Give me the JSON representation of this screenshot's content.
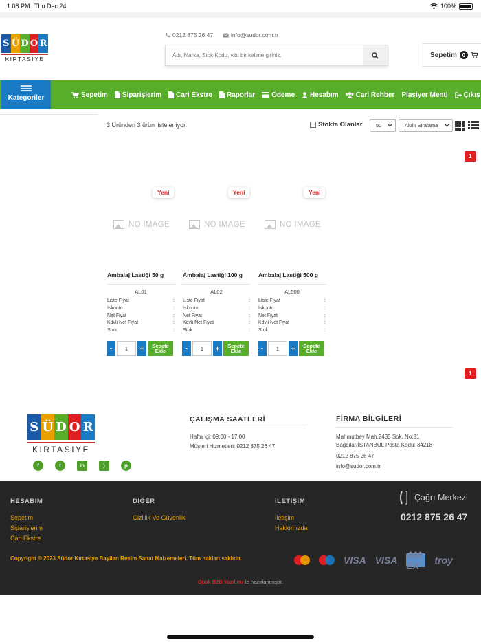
{
  "status_bar": {
    "time": "1:08 PM",
    "date": "Thu Dec 24",
    "battery": "100%"
  },
  "header": {
    "logo": {
      "letters": [
        "S",
        "Ü",
        "D",
        "O",
        "R"
      ],
      "tile_colors": [
        "#1a5aa8",
        "#e8a100",
        "#58ae2b",
        "#e02020",
        "#1a7bc4"
      ],
      "sub": "KIRTASIYE"
    },
    "phone": "0212 875 26 47",
    "email": "info@sudor.com.tr",
    "search_placeholder": "Adı, Marka, Stok Kodu, v.b. bir kelime giriniz.",
    "basket_label": "Sepetim",
    "basket_count": "0"
  },
  "nav": {
    "categories_label": "Kategoriler",
    "items": [
      {
        "label": "Sepetim",
        "icon": "cart-icon"
      },
      {
        "label": "Siparişlerim",
        "icon": "document-icon"
      },
      {
        "label": "Cari Ekstre",
        "icon": "document-icon"
      },
      {
        "label": "Raporlar",
        "icon": "document-icon"
      },
      {
        "label": "Ödeme",
        "icon": "card-icon"
      },
      {
        "label": "Hesabım",
        "icon": "user-icon"
      },
      {
        "label": "Cari Rehber",
        "icon": "users-icon"
      },
      {
        "label": "Plasiyer Menü",
        "icon": ""
      },
      {
        "label": "Çıkış",
        "icon": "logout-icon"
      }
    ],
    "colors": {
      "nav": "#58ae2b",
      "categories": "#1a7bc4"
    }
  },
  "listing": {
    "result_text": "3 Üründen 3 ürün listeleniyor.",
    "stock_only_label": "Stokta Olanlar",
    "page_size": "50",
    "sort": "Akıllı Sıralama",
    "page_badge": "1"
  },
  "products": [
    {
      "badge": "Yeni",
      "no_image": "NO IMAGE",
      "name": "Ambalaj Lastiği 50 g",
      "code": "AL01"
    },
    {
      "badge": "Yeni",
      "no_image": "NO IMAGE",
      "name": "Ambalaj Lastiği 100 g",
      "code": "AL02"
    },
    {
      "badge": "Yeni",
      "no_image": "NO IMAGE",
      "name": "Ambalaj Lastiği 500 g",
      "code": "AL500"
    }
  ],
  "product_fields": [
    "Liste Fiyat",
    "İskonto",
    "Net Fiyat",
    "Kdvli Net Fiyat",
    "Stok"
  ],
  "product_actions": {
    "minus": "-",
    "qty": "1",
    "plus": "+",
    "add_to_cart": "Sepete Ekle"
  },
  "footer": {
    "hours_title": "ÇALIŞMA SAATLERİ",
    "hours": [
      "Hafta içi: 09:00 - 17:00",
      "Müşteri Hizmetleri: 0212 875 26 47"
    ],
    "company_title": "FİRMA BİLGİLERİ",
    "company": [
      "Mahmutbey Mah.2435 Sok. No:81",
      "Bağcılar/İSTANBUL Posta Kodu: 34218",
      "0212 875 26 47",
      "info@sudor.com.tr"
    ],
    "social": [
      "facebook-icon",
      "twitter-icon",
      "linkedin-icon",
      "rss-icon",
      "pinterest-icon"
    ]
  },
  "bottom": {
    "col1_title": "HESABIM",
    "col1": [
      "Sepetim",
      "Siparişlerim",
      "Cari Ekstre"
    ],
    "col2_title": "DİĞER",
    "col2": [
      "Gizlilik Ve Güvenlik"
    ],
    "col3_title": "İLETİŞİM",
    "col3": [
      "İletişim",
      "Hakkımızda"
    ],
    "call_center": "Çağrı Merkezi",
    "call_phone": "0212 875 26 47",
    "copyright": "Copyright © 2023 Südor Kırtasiye Bayilan Resim Sanat Malzemeleri. Tüm hakları saklıdır.",
    "opak_brand": "Opak B2B Yazılımı",
    "opak_suffix": " ile hazırlanmıştır.",
    "payment": [
      "mastercard-icon",
      "maestro-icon",
      "VISA",
      "VISA",
      "amex-icon",
      "troy"
    ]
  }
}
